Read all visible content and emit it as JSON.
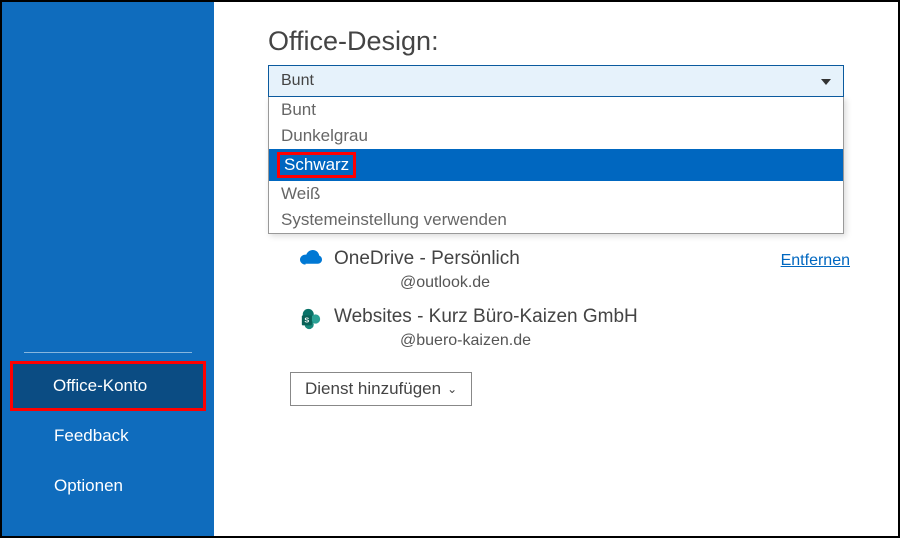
{
  "sidebar": {
    "items": [
      {
        "label": "Office-Konto"
      },
      {
        "label": "Feedback"
      },
      {
        "label": "Optionen"
      }
    ]
  },
  "main": {
    "section_title": "Office-Design:",
    "dropdown": {
      "selected": "Bunt",
      "options": [
        "Bunt",
        "Dunkelgrau",
        "Schwarz",
        "Weiß",
        "Systemeinstellung verwenden"
      ]
    },
    "services": [
      {
        "name": "OneDrive - Persönlich",
        "detail": "@outlook.de",
        "remove_label": "Entfernen"
      },
      {
        "name": "Websites - Kurz Büro-Kaizen GmbH",
        "detail": "@buero-kaizen.de"
      }
    ],
    "add_service_label": "Dienst hinzufügen"
  }
}
